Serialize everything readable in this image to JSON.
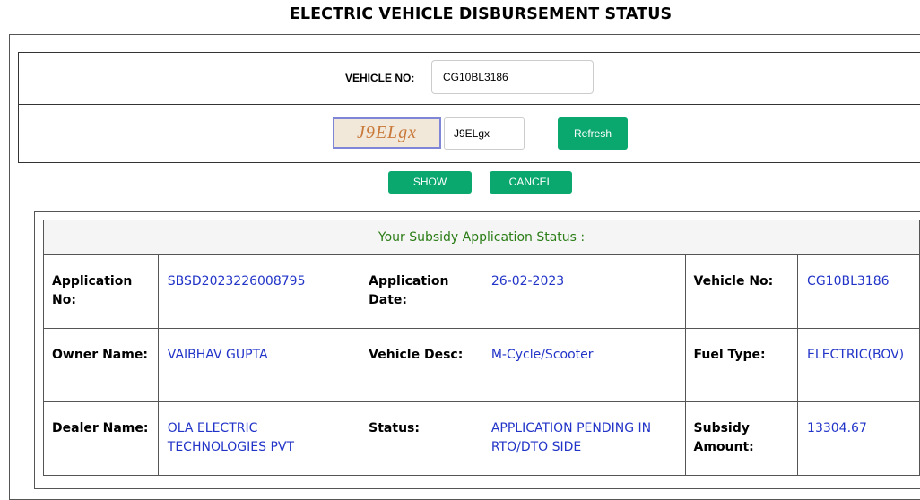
{
  "page": {
    "title": "ELECTRIC VEHICLE DISBURSEMENT STATUS"
  },
  "form": {
    "vehicle_no_label": "VEHICLE NO:",
    "vehicle_no_value": "CG10BL3186",
    "captcha_image_text": "J9ELgx",
    "captcha_input_value": "J9ELgx",
    "refresh_label": "Refresh",
    "show_label": "SHOW",
    "cancel_label": "CANCEL"
  },
  "status": {
    "header": "Your Subsidy Application Status :",
    "rows": [
      [
        {
          "label": "Application No:",
          "value": "SBSD2023226008795"
        },
        {
          "label": "Application Date:",
          "value": "26-02-2023"
        },
        {
          "label": "Vehicle No:",
          "value": "CG10BL3186"
        }
      ],
      [
        {
          "label": "Owner Name:",
          "value": "VAIBHAV GUPTA"
        },
        {
          "label": "Vehicle Desc:",
          "value": "M-Cycle/Scooter"
        },
        {
          "label": "Fuel Type:",
          "value": "ELECTRIC(BOV)"
        }
      ],
      [
        {
          "label": "Dealer Name:",
          "value": "OLA ELECTRIC TECHNOLOGIES PVT"
        },
        {
          "label": "Status:",
          "value": "APPLICATION PENDING IN RTO/DTO SIDE"
        },
        {
          "label": "Subsidy Amount:",
          "value": "13304.67"
        }
      ]
    ]
  },
  "colors": {
    "button": "#0aa86f",
    "value_text": "#2234c8",
    "header_text": "#2b7d16"
  }
}
